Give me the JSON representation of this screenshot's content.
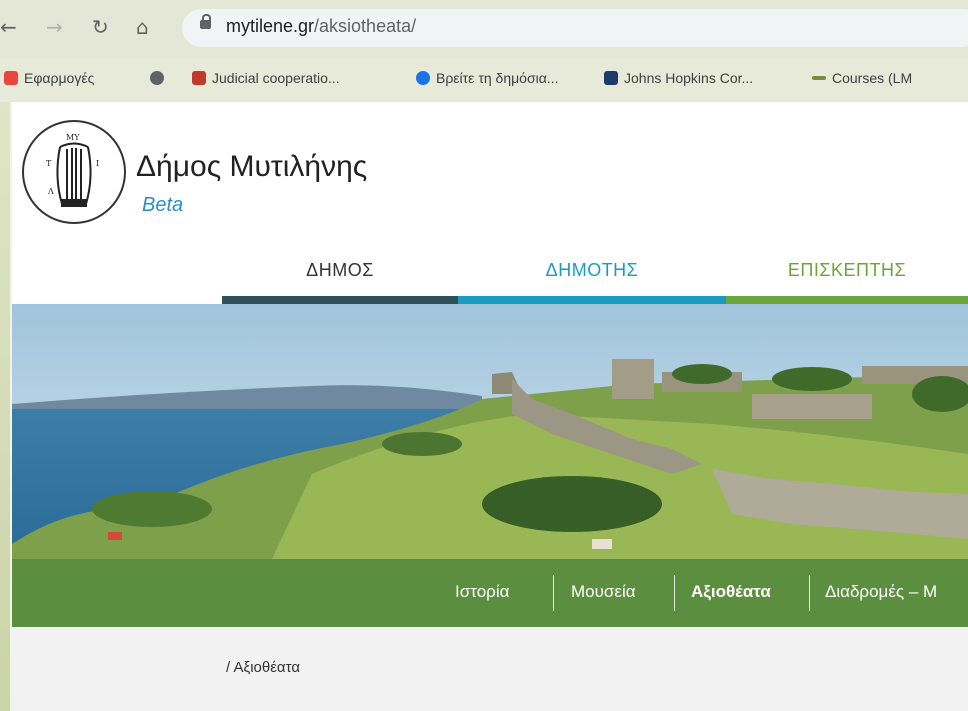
{
  "browser": {
    "url_host": "mytilene.gr",
    "url_path": "/aksiotheata/",
    "bookmarks": [
      {
        "label": "Εφαρμογές",
        "color": "#e8453c"
      },
      {
        "label": "",
        "color": "#5f6368"
      },
      {
        "label": "Judicial cooperatio...",
        "color": "#c0392b"
      },
      {
        "label": "Βρείτε τη δημόσια...",
        "color": "#1a73e8"
      },
      {
        "label": "Johns Hopkins Cor...",
        "color": "#1f3a6e"
      },
      {
        "label": "Courses (LM",
        "color": "#7a8c3a"
      }
    ]
  },
  "site": {
    "title": "Δήμος Μυτιλήνης",
    "beta": "Beta",
    "main_nav": [
      {
        "label": "ΔΗΜΟΣ",
        "color": "#2f4f5a",
        "text_color": "#333333"
      },
      {
        "label": "ΔΗΜΟΤΗΣ",
        "color": "#1a9cc2",
        "text_color": "#1a9cc2"
      },
      {
        "label": "ΕΠΙΣΚΕΠΤΗΣ",
        "color": "#6aa43a",
        "text_color": "#6aa43a"
      }
    ],
    "sub_nav": [
      {
        "label": "Ιστορία",
        "active": false
      },
      {
        "label": "Μουσεία",
        "active": false
      },
      {
        "label": "Αξιοθέατα",
        "active": true
      },
      {
        "label": "Διαδρομές – Μ",
        "active": false
      }
    ],
    "breadcrumb": "/ Αξιοθέατα",
    "colors": {
      "subnav_bg": "#5b8e3e"
    }
  }
}
